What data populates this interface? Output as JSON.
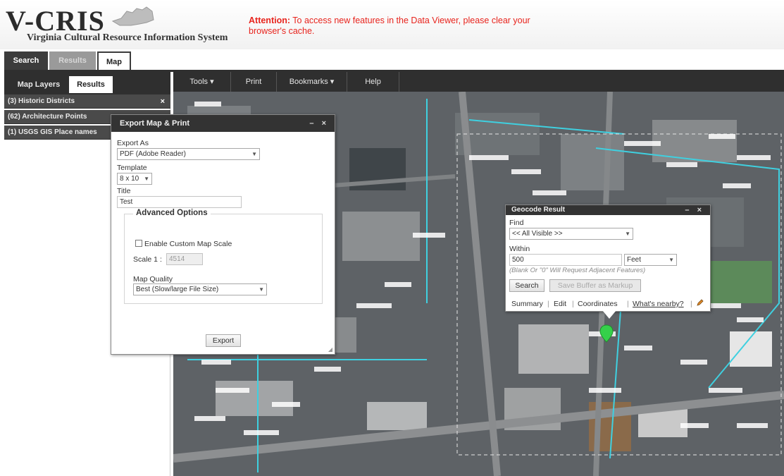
{
  "header": {
    "logo_word": "V-CRIS",
    "logo_subtitle": "Virginia Cultural Resource Information System",
    "attention_label": "Attention:",
    "attention_text": "To access new features in the Data Viewer, please clear your browser's cache."
  },
  "top_tabs": {
    "search": "Search",
    "results": "Results",
    "map": "Map"
  },
  "left_panel": {
    "tabs": {
      "map_layers": "Map Layers",
      "results": "Results"
    },
    "rows": [
      "(3) Historic Districts",
      "(62) Architecture Points",
      "(1) USGS GIS Place names"
    ],
    "close_glyph": "×"
  },
  "toolbar": {
    "tools": "Tools",
    "print": "Print",
    "bookmarks": "Bookmarks",
    "help": "Help",
    "dropdown_glyph": "▾"
  },
  "export_dialog": {
    "title": "Export Map & Print",
    "export_as_label": "Export As",
    "export_as_value": "PDF (Adobe Reader)",
    "template_label": "Template",
    "template_value": "8 x 10",
    "title_label": "Title",
    "title_value": "Test",
    "advanced_options": "Advanced Options",
    "custom_scale_label": "Enable Custom Map Scale",
    "scale_label": "Scale 1 :",
    "scale_value": "4514",
    "map_quality_label": "Map Quality",
    "map_quality_value": "Best (Slow/large File Size)",
    "export_button": "Export",
    "controls": "– ×"
  },
  "geocode_dialog": {
    "title": "Geocode Result",
    "find_label": "Find",
    "find_value": "<< All Visible >>",
    "within_label": "Within",
    "within_value": "500",
    "unit_value": "Feet",
    "hint": "(Blank Or \"0\" Will Request Adjacent Features)",
    "search_button": "Search",
    "save_buffer_button": "Save Buffer as Markup",
    "links": [
      "Summary",
      "Edit",
      "Coordinates",
      "What's nearby?"
    ],
    "controls": "– ×"
  },
  "colors": {
    "dark_bar": "#2f2f2f",
    "attention_red": "#e8241d",
    "parcel_cyan": "#3fd0e0",
    "marker_green": "#35d04a"
  },
  "icons": {
    "marker": "map-pin-icon",
    "edit_pencil": "pencil-icon",
    "virginia_state": "virginia-state-icon"
  }
}
